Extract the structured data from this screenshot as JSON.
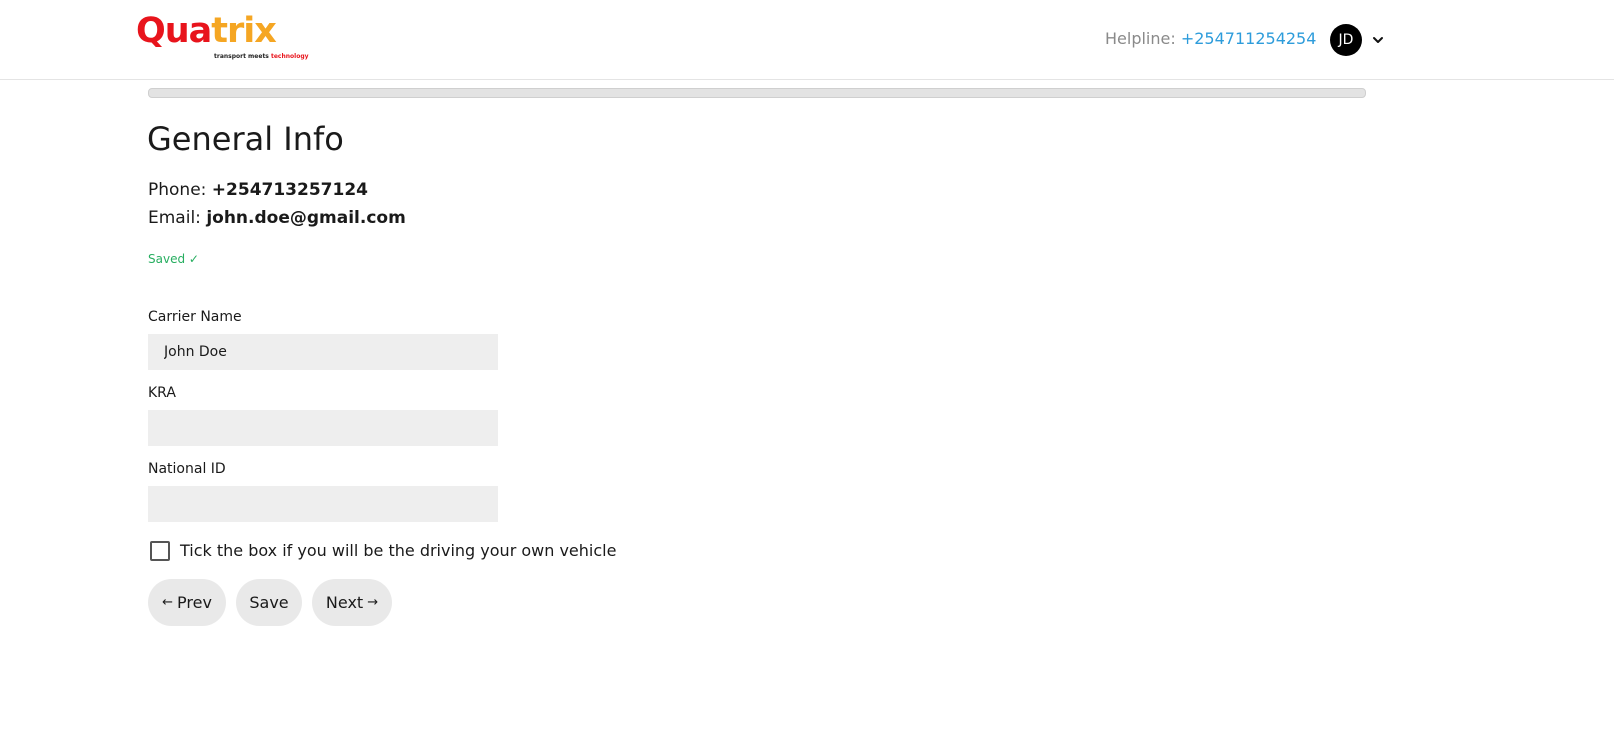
{
  "header": {
    "logo": {
      "word_part1": "Qua",
      "word_part2": "trix",
      "tagline_part1": "transport meets ",
      "tagline_part2": "technology"
    },
    "helpline_label": "Helpline:",
    "helpline_number": "+254711254254",
    "avatar_initials": "JD",
    "menu_icon": "chevron-down-icon"
  },
  "colors": {
    "brand_red": "#e8141c",
    "brand_orange": "#f5a623",
    "link_blue": "#2d9cdb",
    "saved_green": "#27ae60"
  },
  "progress": {
    "value": 0
  },
  "main": {
    "title": "General Info",
    "phone_label": "Phone:",
    "phone_value": "+254713257124",
    "email_label": "Email:",
    "email_value": "john.doe@gmail.com",
    "saved_status": "Saved ✓",
    "fields": {
      "carrier_name": {
        "label": "Carrier Name",
        "value": "John Doe"
      },
      "kra": {
        "label": "KRA",
        "value": ""
      },
      "national_id": {
        "label": "National ID",
        "value": ""
      }
    },
    "drive_own_vehicle": {
      "label": "Tick the box if you will be the driving your own vehicle",
      "checked": false
    },
    "buttons": {
      "prev": {
        "arrow": "←",
        "label": "Prev"
      },
      "save": {
        "label": "Save"
      },
      "next": {
        "label": "Next",
        "arrow": "→"
      }
    }
  }
}
